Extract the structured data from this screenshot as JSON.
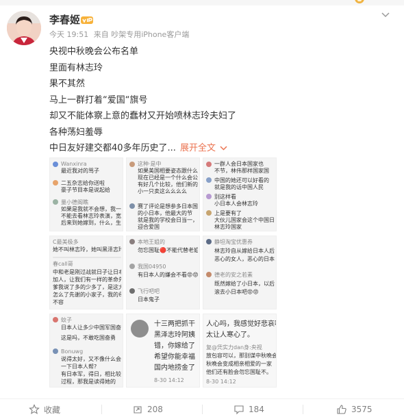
{
  "post": {
    "username": "李春姬",
    "time": "今天 19:51",
    "source": "来自 吵架专用iPhone客户端",
    "lines": [
      "央视中秋晚会公布名单",
      "里面有林志玲",
      "果不其然",
      "马上一群打着“爱国“旗号",
      "却又不能体察上意的蠢材又开始喷林志玲夫妇了",
      "各种荡妇羞辱",
      "中日友好建交都40多年历史了..."
    ],
    "expand_label": "展开全文"
  },
  "thumbs": [
    {
      "lines": [
        "Wanxinra",
        "最近我对的骂子",
        "二五杂志给你送啦",
        "豪子节目本是说起给",
        "量小德阁瞧",
        "如果是我就不会想，我一个人",
        "不能去看林志玲表演，宽恕你们",
        "后来到她嫁到，什么，生到日本人"
      ]
    },
    {
      "lines": [
        "这种·是中",
        "如果美国相要姿态跟什么节目，",
        "现在已经是一个什么会公告",
        "有好几个比较，他们新的关系",
        "小一只卖这么么么么",
        "赛了评论是想参多日本国民",
        "的小日本，他最大的节",
        "就是我的学校会日当一，嘛",
        "迎合爱国"
      ]
    },
    {
      "lines": [
        "一群人会日本国家也",
        "不节，林伟那样国家国",
        "中国的她还可以好看的",
        "就是我的话中国人民",
        "别这样看",
        "小日本人会林志玲",
        "上是要有了",
        "大伙儿国家会这个中国日本国家",
        "林志玲国家"
      ]
    },
    {
      "lines": [
        "C最美极多",
        "她不叫林志玲，她叫黑泽志玲，谢谢",
        "春call哥",
        "中和老是刚过战就日子让日本人",
        "加人，让我们有一样的革命先和怎么作",
        "爹我说了多的少多了，是这大部上半年",
        "怎么了先谢的小家子，我的母在",
        "不容"
      ]
    },
    {
      "lines": [
        "本地王姐的",
        "勿忘国耻🔴不能代替老姐有",
        "我国04950",
        "有日本人的嫌会不看😡😡",
        "飞行吧吧",
        "日本鬼子"
      ]
    },
    {
      "lines": [
        "静坦淘宝优惠券",
        "林志玲自从嫁给日本人后，我",
        "恶心的女人，恶心的日本人",
        "德老的安之若素",
        "既然嫁给了小日本，以后就少",
        "滚去小日本吧😡😡"
      ]
    },
    {
      "lines": [
        "蚊子",
        "日本人让多少中国军国奋勇了吗?",
        "这是吗，不敢吃国奋勇",
        "Bonuwg",
        "说得太好，又不像什么会不可少的人，为首",
        "一下日本人帮?",
        "有日本军，得日，相比较会有日本的",
        "过程，那我是读得她的"
      ]
    },
    {
      "lines": [
        "十三两把抓干",
        "黑泽志玲阿姨",
        "错，你嫁给了",
        "希望你能幸福",
        "国内地捞金了",
        "8-30 14:12"
      ]
    },
    {
      "lines": [
        "人心吗，我感觉好悲哀啊，",
        "太让人寒心了。",
        "复@凭实力dan身:央视",
        "放包容可以，那别谋中秋晚会",
        "秋晚会变成相亲相爱的一家",
        "他们还有脸会勿忘国耻不。",
        "8-30 14:12"
      ]
    }
  ],
  "actions": {
    "favorite": "收藏",
    "repost": "208",
    "comment": "184",
    "like": "3575"
  }
}
